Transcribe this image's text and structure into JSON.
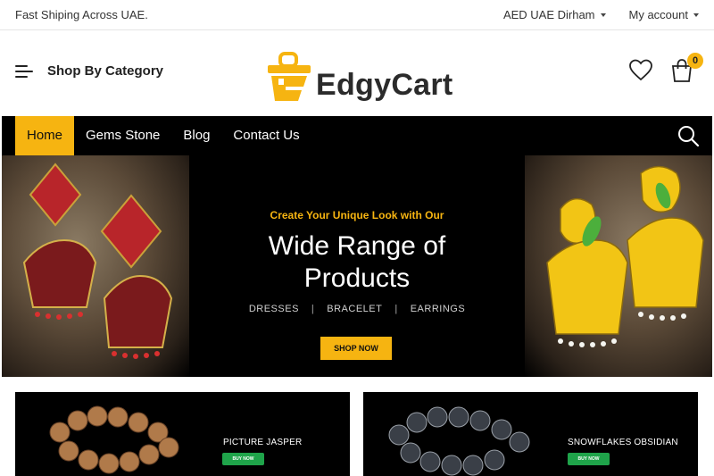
{
  "topbar": {
    "shipping_text": "Fast Shiping Across UAE.",
    "currency_label": "AED UAE Dirham",
    "account_label": "My account"
  },
  "header": {
    "category_label": "Shop By Category",
    "logo_text": "EdgyCart",
    "cart_count": "0"
  },
  "nav": {
    "items": [
      {
        "label": "Home",
        "active": true
      },
      {
        "label": "Gems Stone"
      },
      {
        "label": "Blog"
      },
      {
        "label": "Contact Us"
      }
    ]
  },
  "hero": {
    "tagline": "Create Your Unique Look with Our",
    "headline_line1": "Wide Range of",
    "headline_line2": "Products",
    "categories": [
      "DRESSES",
      "BRACELET",
      "EARRINGS"
    ],
    "cta_label": "SHOP NOW"
  },
  "promos": [
    {
      "title": "PICTURE JASPER",
      "cta": "BUY NOW"
    },
    {
      "title": "SNOWFLAKES OBSIDIAN",
      "cta": "BUY NOW"
    }
  ],
  "colors": {
    "accent": "#f6b411",
    "nav_bg": "#000000",
    "buy_button": "#1fa34a"
  }
}
